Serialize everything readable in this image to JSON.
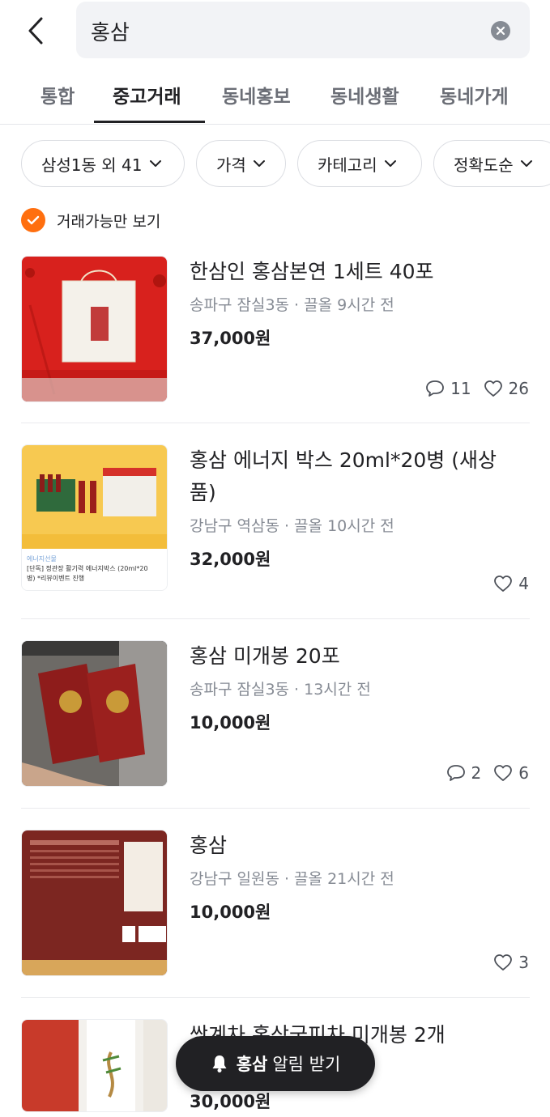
{
  "search": {
    "query": "홍삼"
  },
  "tabs": [
    {
      "label": "통합"
    },
    {
      "label": "중고거래",
      "active": true
    },
    {
      "label": "동네홍보"
    },
    {
      "label": "동네생활"
    },
    {
      "label": "동네가게"
    }
  ],
  "filters": [
    {
      "label": "삼성1동 외 41"
    },
    {
      "label": "가격"
    },
    {
      "label": "카테고리"
    },
    {
      "label": "정확도순"
    }
  ],
  "available_only": {
    "label": "거래가능만 보기",
    "checked": true
  },
  "items": [
    {
      "title": "한삼인 홍삼본연 1세트 40포",
      "location": "송파구 잠실3동",
      "bump": "끌올",
      "time": "9시간 전",
      "price": "37,000원",
      "chats": "11",
      "likes": "26"
    },
    {
      "title": "홍삼 에너지 박스 20ml*20병 (새상품)",
      "location": "강남구 역삼동",
      "bump": "끌올",
      "time": "10시간 전",
      "price": "32,000원",
      "chats": "",
      "likes": "4"
    },
    {
      "title": "홍삼 미개봉 20포",
      "location": "송파구 잠실3동",
      "bump": "",
      "time": "13시간 전",
      "price": "10,000원",
      "chats": "2",
      "likes": "6"
    },
    {
      "title": "홍삼",
      "location": "강남구 일원동",
      "bump": "끌올",
      "time": "21시간 전",
      "price": "10,000원",
      "chats": "",
      "likes": "3"
    },
    {
      "title": "쌍계차 홍삼국피차 미개봉 2개",
      "location": "",
      "bump": "",
      "time": "",
      "price": "30,000원",
      "chats": "",
      "likes": ""
    }
  ],
  "thumb_text": {
    "item2_caption_small": "에너지선물",
    "item2_caption_1": "[단독] 정관장 활기력 에너지박스 (20ml*20",
    "item2_caption_2": "병) *리뷰이벤트 진행"
  },
  "alert_button": {
    "keyword": "홍삼",
    "label": "알림 받기"
  },
  "colors": {
    "accent": "#ff6f0f",
    "text": "#212124",
    "muted": "#868b94"
  }
}
